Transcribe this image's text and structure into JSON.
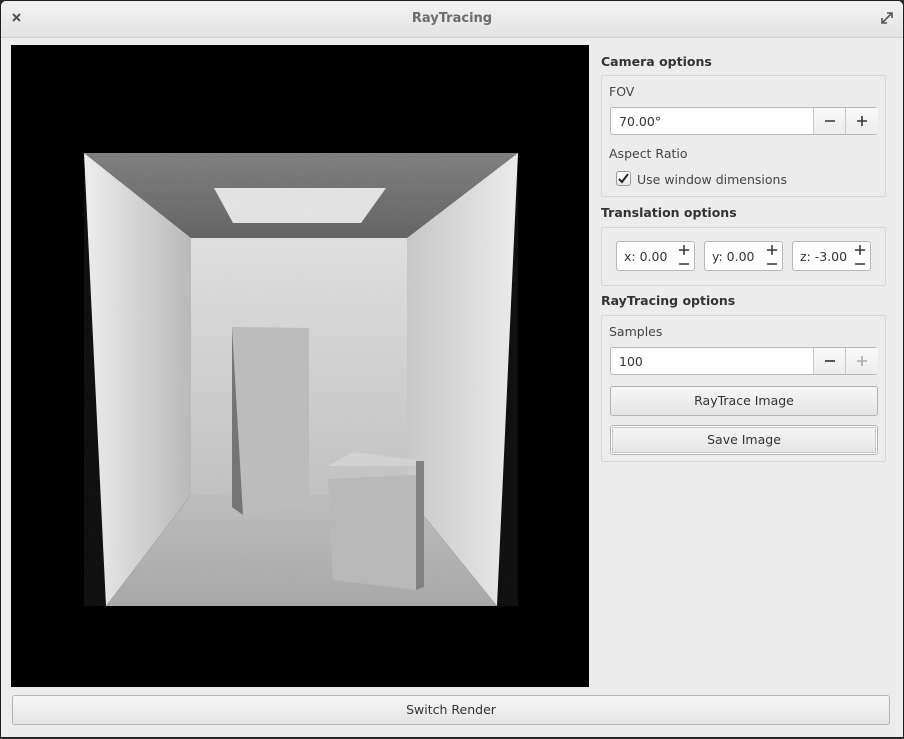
{
  "window": {
    "title": "RayTracing"
  },
  "camera": {
    "section_title": "Camera options",
    "fov_label": "FOV",
    "fov_value": "70.00°",
    "aspect_label": "Aspect Ratio",
    "use_window_label": "Use window dimensions",
    "use_window_checked": true
  },
  "translation": {
    "section_title": "Translation options",
    "x": "x: 0.00",
    "y": "y: 0.00",
    "z": "z: -3.00"
  },
  "raytracing": {
    "section_title": "RayTracing options",
    "samples_label": "Samples",
    "samples_value": "100",
    "raytrace_button": "RayTrace Image",
    "save_button": "Save Image"
  },
  "footer": {
    "switch_button": "Switch Render"
  },
  "icons": {
    "close": "close-icon",
    "maximize": "maximize-icon",
    "minus": "minus-icon",
    "plus": "plus-icon",
    "check": "checkmark-icon"
  }
}
